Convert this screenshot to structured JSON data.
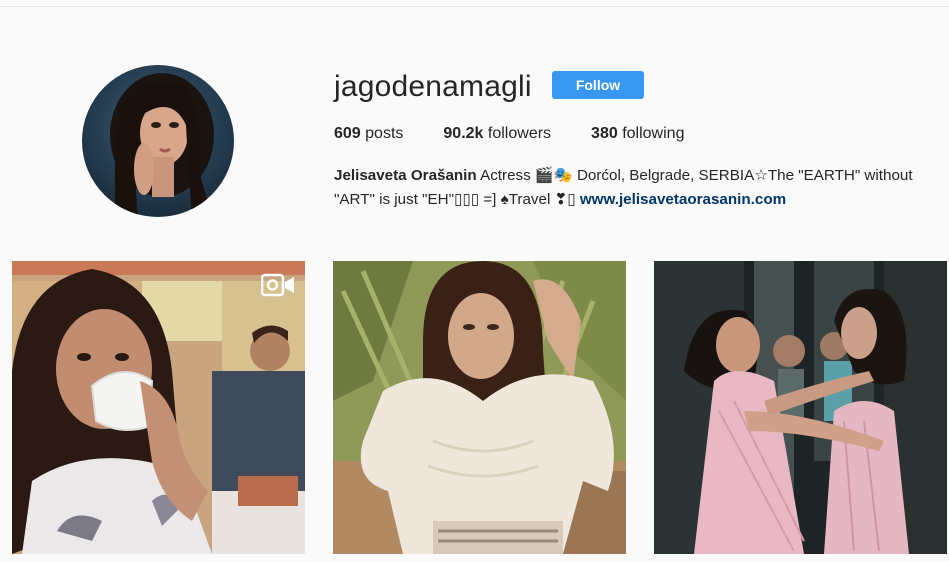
{
  "profile": {
    "username": "jagodenamagli",
    "follow_label": "Follow",
    "stats": {
      "posts_count": "609",
      "posts_label": "posts",
      "followers_count": "90.2k",
      "followers_label": "followers",
      "following_count": "380",
      "following_label": "following"
    },
    "bio": {
      "name": "Jelisaveta Orašanin",
      "line1": " Actress 🎬🎭 Dorćol, Belgrade, SERBIA☆The \"EARTH\" without",
      "line2": "\"ART\" is just \"EH\"▯▯▯ =] ♠Travel ❣▯ ",
      "link": "www.jelisavetaorasanin.com"
    }
  },
  "posts": [
    {
      "type": "video",
      "icon": "video-camera-icon"
    },
    {
      "type": "photo"
    },
    {
      "type": "photo"
    }
  ],
  "colors": {
    "follow_button": "#3897f0",
    "link": "#003569",
    "background": "#fafafa"
  }
}
